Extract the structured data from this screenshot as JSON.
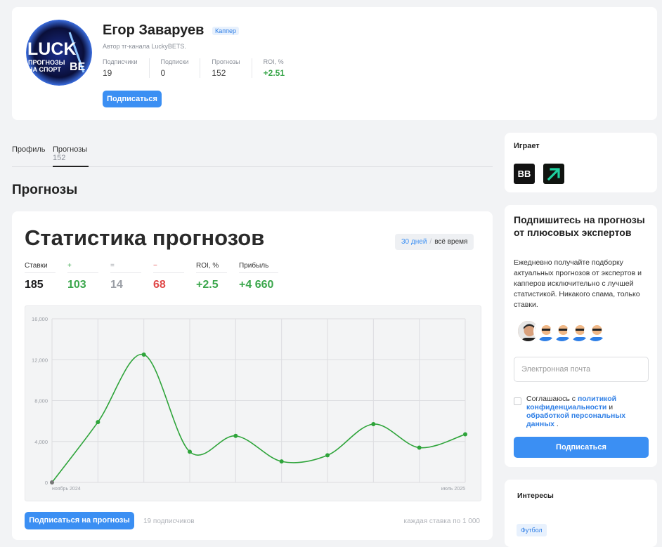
{
  "profile": {
    "name": "Егор Заваруев",
    "badge": "Каппер",
    "subtitle": "Автор тг-канала LuckyBETS.",
    "avatar_text_top": "LUCK",
    "avatar_text_side": "BE",
    "avatar_text_line1": "ПРОГНОЗЫ",
    "avatar_text_line2": "НА СПОРТ",
    "stats": [
      {
        "label": "Подписчики",
        "value": "19"
      },
      {
        "label": "Подписки",
        "value": "0"
      },
      {
        "label": "Прогнозы",
        "value": "152"
      },
      {
        "label": "ROI, %",
        "value": "+2.51"
      }
    ],
    "subscribe_label": "Подписаться"
  },
  "tabs": [
    {
      "label": "Профиль",
      "count": ""
    },
    {
      "label": "Прогнозы",
      "count": "152"
    }
  ],
  "section_title": "Прогнозы",
  "stats_card": {
    "title": "Статистика прогнозов",
    "period_30": "30 дней",
    "period_sep": "/",
    "period_all": "всё время",
    "metrics": [
      {
        "label": "Ставки",
        "value": "185"
      },
      {
        "label": "+",
        "value": "103"
      },
      {
        "label": "=",
        "value": "14"
      },
      {
        "label": "−",
        "value": "68"
      },
      {
        "label": "ROI, %",
        "value": "+2.5"
      },
      {
        "label": "Прибыль",
        "value": "+4 660"
      }
    ],
    "subscribe_label": "Подписаться на прогнозы",
    "subscribers_text": "19 подписчиков",
    "each_bet_text": "каждая ставка по 1 000"
  },
  "chart_data": {
    "type": "line",
    "x_labels": [
      "ноябрь 2024",
      "июль 2025"
    ],
    "y_ticks": [
      "0",
      "4,000",
      "8,000",
      "12,000",
      "16,000"
    ],
    "ylim": [
      0,
      16000
    ],
    "values": [
      0,
      5900,
      12500,
      3000,
      4550,
      2050,
      2650,
      5700,
      3400,
      4700
    ],
    "grid": true,
    "line_color": "#2ea43a",
    "xlabel": "",
    "ylabel": "",
    "title": ""
  },
  "plays": {
    "title": "Играет",
    "bk1_label": "BB",
    "bk2_icon": "arrow-up-right-icon"
  },
  "promo": {
    "title": "Подпишитесь на прогнозы от плюсовых экспертов",
    "text": "Ежедневно получайте подборку актуальных прогнозов от экспертов и капперов исключительно с лучшей статистикой. Никакого спама, только ставки.",
    "email_placeholder": "Электронная почта",
    "consent_prefix": "Соглашаюсь с ",
    "consent_link1": "политикой конфиденциальности",
    "consent_mid": " и ",
    "consent_link2": "обработкой персональных данных",
    "consent_suffix": " .",
    "subscribe_label": "Подписаться"
  },
  "interests": {
    "title": "Интересы",
    "tag": "Футбол"
  },
  "colors": {
    "accent": "#3b8ff3",
    "green": "#3aa64b",
    "red": "#e04848"
  }
}
